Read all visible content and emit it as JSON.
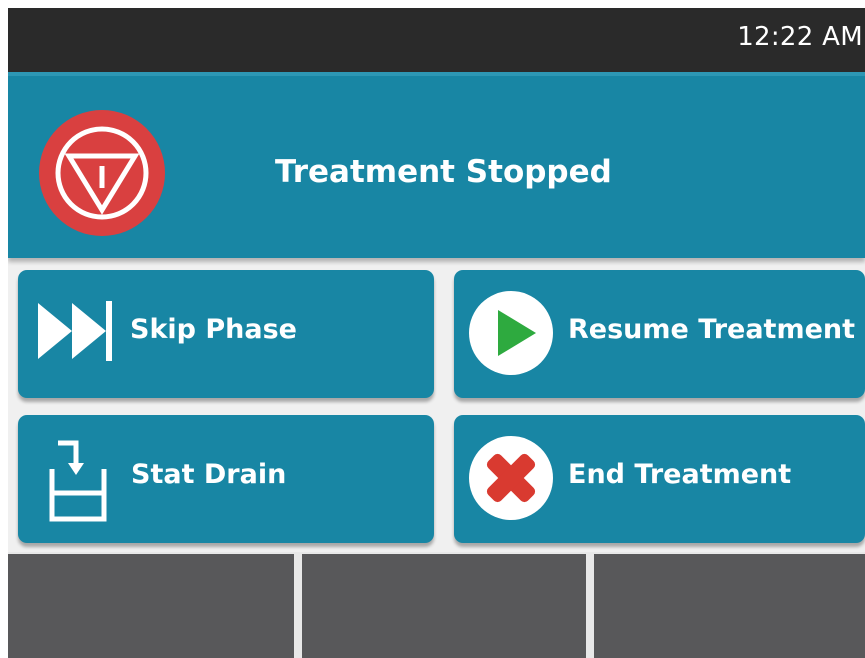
{
  "status_bar": {
    "time": "12:22 AM"
  },
  "header": {
    "title": "Treatment Stopped",
    "icon": "stop-icon",
    "icon_color": "#d94040"
  },
  "actions": {
    "skip_phase": {
      "label": "Skip Phase",
      "icon": "fast-forward-icon"
    },
    "resume_treatment": {
      "label": "Resume Treatment",
      "icon": "play-icon"
    },
    "stat_drain": {
      "label": "Stat Drain",
      "icon": "drain-icon"
    },
    "end_treatment": {
      "label": "End Treatment",
      "icon": "close-icon"
    }
  },
  "colors": {
    "button_bg": "#1886a4",
    "header_bg": "#1886a4",
    "status_bar_bg": "#2a2a2a",
    "nav_bg": "#58585a",
    "play_green": "#2eaa3f",
    "end_red": "#d93a30"
  }
}
